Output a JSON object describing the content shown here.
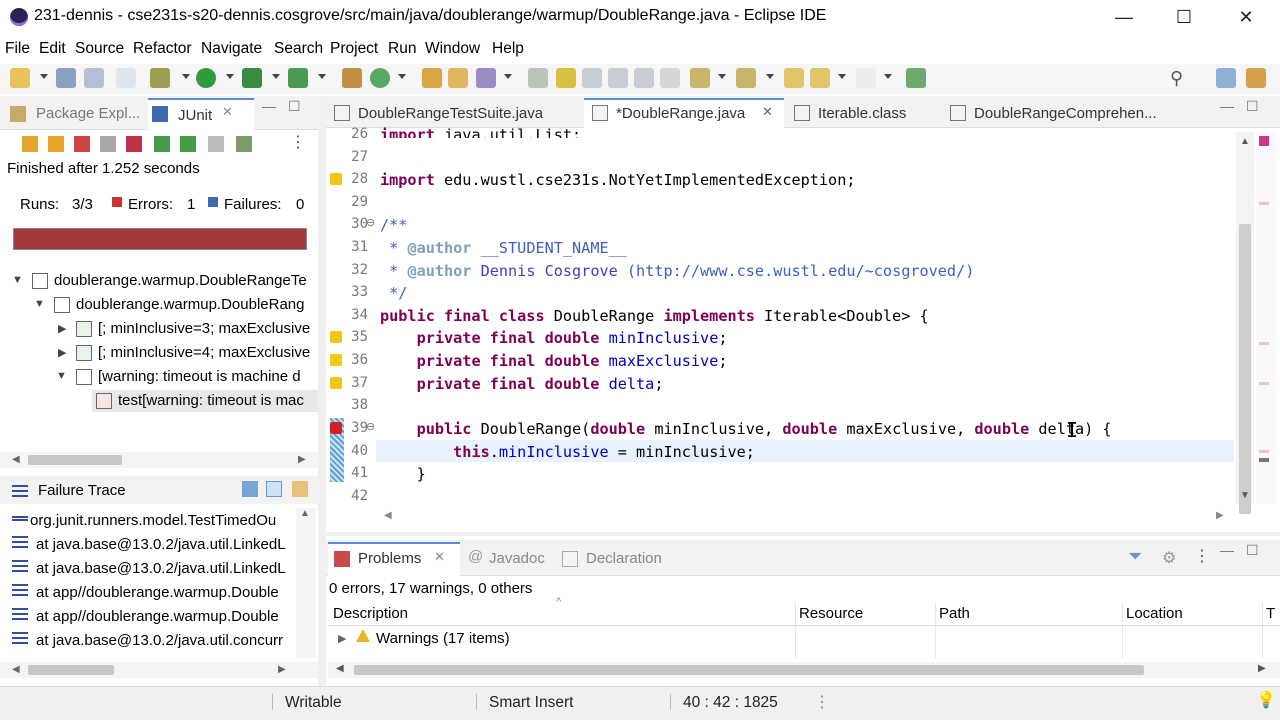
{
  "window": {
    "title": "231-dennis - cse231s-s20-dennis.cosgrove/src/main/java/doublerange/warmup/DoubleRange.java - Eclipse IDE",
    "minimize": "—",
    "maximize": "☐",
    "close": "✕"
  },
  "menu": [
    "File",
    "Edit",
    "Source",
    "Refactor",
    "Navigate",
    "Search",
    "Project",
    "Run",
    "Window",
    "Help"
  ],
  "left_tabs": {
    "package_explorer": "Package Expl...",
    "junit": "JUnit"
  },
  "junit": {
    "finished": "Finished after 1.252 seconds",
    "runs_label": "Runs:",
    "runs_value": "3/3",
    "errors_label": "Errors:",
    "errors_value": "1",
    "failures_label": "Failures:",
    "failures_value": "0",
    "bar_color": "#a33a3a",
    "tree": [
      "doublerange.warmup.DoubleRangeTe",
      "doublerange.warmup.DoubleRang",
      "[; minInclusive=3; maxExclusive",
      "[; minInclusive=4; maxExclusive",
      "[warning: timeout is machine d",
      "test[warning: timeout is mac"
    ],
    "failure_trace_label": "Failure Trace",
    "trace": [
      "org.junit.runners.model.TestTimedOu",
      "at java.base@13.0.2/java.util.LinkedL",
      "at java.base@13.0.2/java.util.LinkedL",
      "at app//doublerange.warmup.Double",
      "at app//doublerange.warmup.Double",
      "at java.base@13.0.2/java.util.concurr"
    ]
  },
  "editor_tabs": [
    {
      "label": "DoubleRangeTestSuite.java",
      "active": false
    },
    {
      "label": "*DoubleRange.java",
      "active": true
    },
    {
      "label": "Iterable.class",
      "active": false
    },
    {
      "label": "DoubleRangeComprehen...",
      "active": false
    }
  ],
  "code": {
    "lines": [
      {
        "num": "26",
        "text": "import java.util.List;"
      },
      {
        "num": "27",
        "text": ""
      },
      {
        "num": "28",
        "text": "import edu.wustl.cse231s.NotYetImplementedException;"
      },
      {
        "num": "29",
        "text": ""
      },
      {
        "num": "30",
        "text": "/**"
      },
      {
        "num": "31",
        "text": " * @author __STUDENT_NAME__"
      },
      {
        "num": "32",
        "text": " * @author Dennis Cosgrove (http://www.cse.wustl.edu/~cosgroved/)"
      },
      {
        "num": "33",
        "text": " */"
      },
      {
        "num": "34",
        "text": "public final class DoubleRange implements Iterable<Double> {"
      },
      {
        "num": "35",
        "text": "    private final double minInclusive;"
      },
      {
        "num": "36",
        "text": "    private final double maxExclusive;"
      },
      {
        "num": "37",
        "text": "    private final double delta;"
      },
      {
        "num": "38",
        "text": ""
      },
      {
        "num": "39",
        "text": "    public DoubleRange(double minInclusive, double maxExclusive, double delta) {"
      },
      {
        "num": "40",
        "text": "        this.minInclusive = minInclusive;"
      },
      {
        "num": "41",
        "text": "    }"
      },
      {
        "num": "42",
        "text": ""
      }
    ]
  },
  "bottom_tabs": {
    "problems": "Problems",
    "javadoc": "Javadoc",
    "declaration": "Declaration"
  },
  "problems": {
    "summary": "0 errors, 17 warnings, 0 others",
    "columns": [
      "Description",
      "Resource",
      "Path",
      "Location",
      "T"
    ],
    "rows": [
      {
        "label": "Warnings (17 items)"
      }
    ]
  },
  "status": {
    "writable": "Writable",
    "insert_mode": "Smart Insert",
    "position": "40 : 42 : 1825"
  }
}
